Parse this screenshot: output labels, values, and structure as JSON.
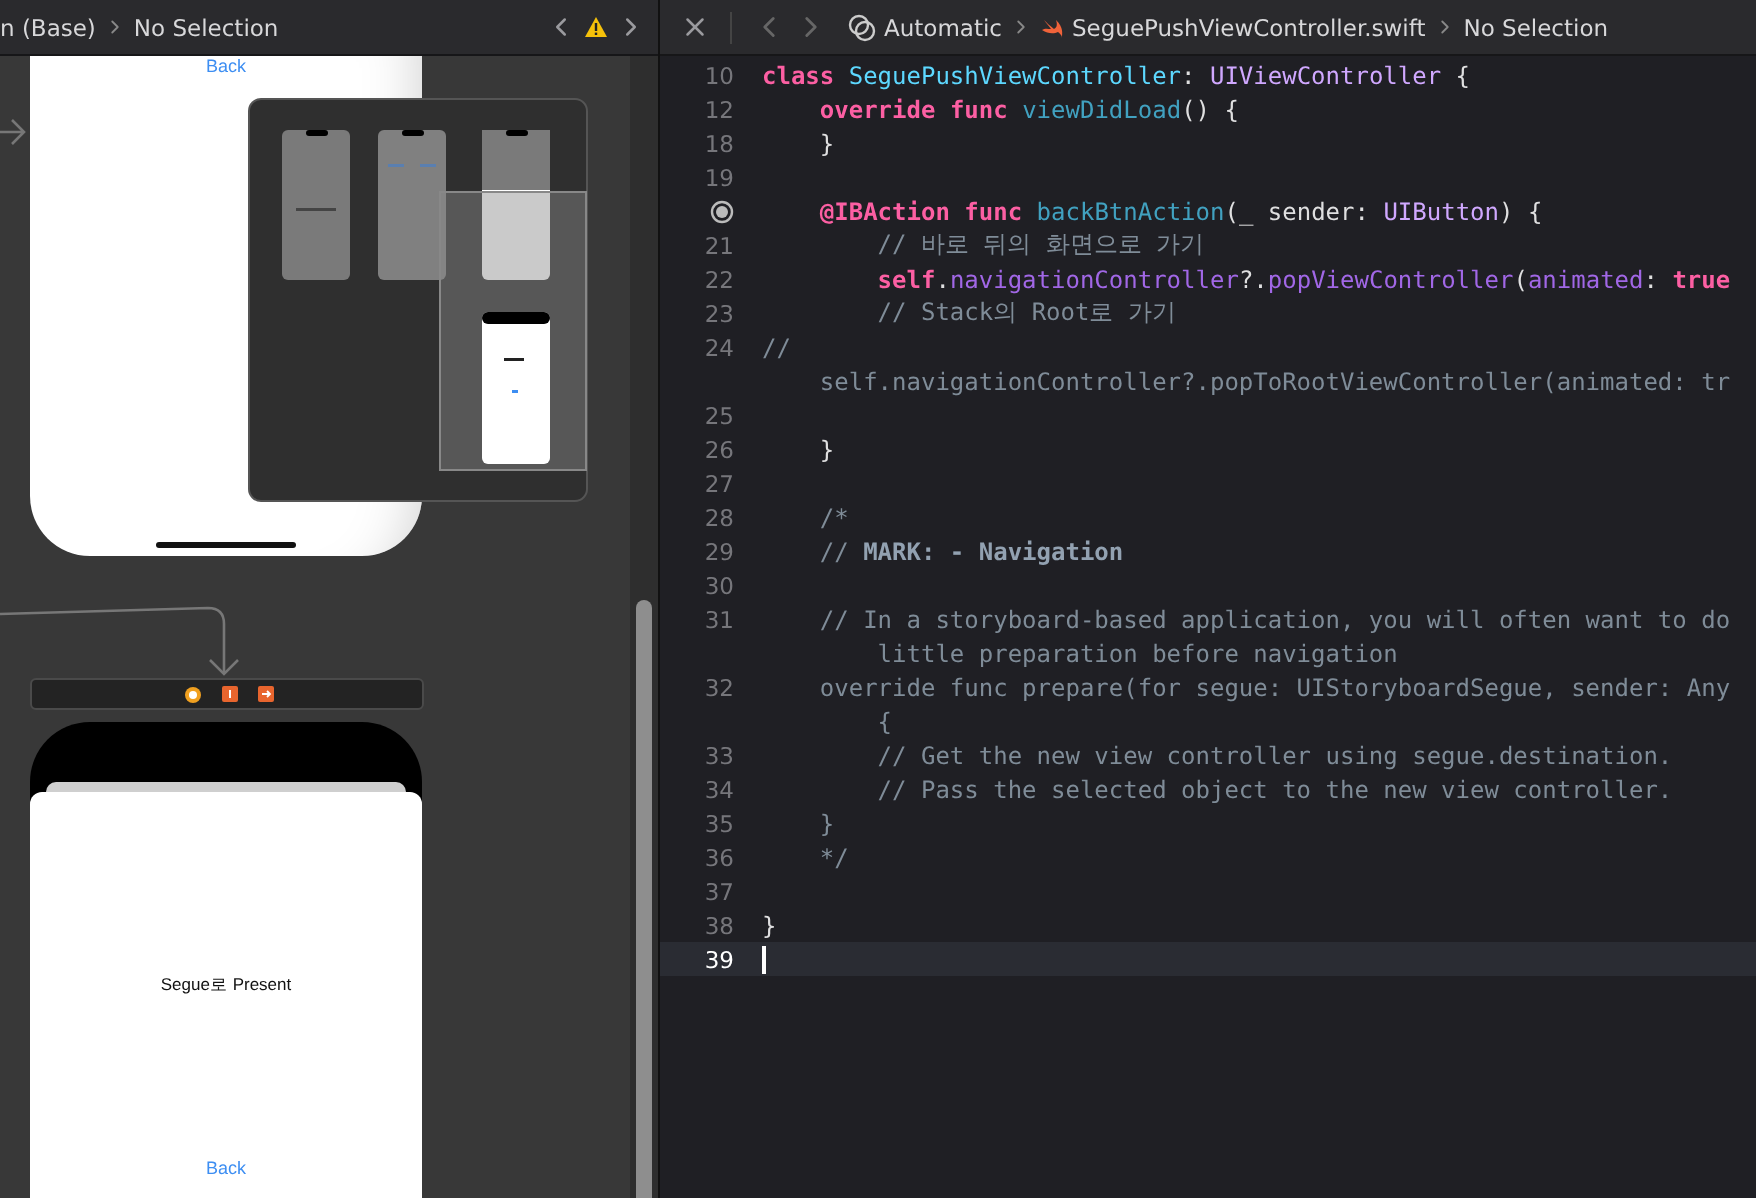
{
  "storyboard_bar": {
    "breadcrumb": [
      "n (Base)",
      "No Selection"
    ]
  },
  "storyboard": {
    "scenes": [
      {
        "kind": "pushed",
        "button": "Back"
      },
      {
        "kind": "presented",
        "label": "Segue로 Present",
        "button": "Back"
      }
    ]
  },
  "editor_bar": {
    "scheme": "Automatic",
    "file": "SeguePushViewController.swift",
    "selection": "No Selection"
  },
  "code": {
    "lines": [
      {
        "number": "10",
        "breakpoint": false,
        "selected": false,
        "rows": [
          [
            {
              "kind": "keyword",
              "text": "class"
            },
            {
              "kind": "plain",
              "text": " "
            },
            {
              "kind": "decl_type",
              "text": "SeguePushViewController"
            },
            {
              "kind": "plain",
              "text": ": "
            },
            {
              "kind": "type",
              "text": "UIViewController"
            },
            {
              "kind": "plain",
              "text": " {"
            }
          ]
        ]
      },
      {
        "number": "12",
        "breakpoint": false,
        "selected": false,
        "rows": [
          [
            {
              "kind": "keyword",
              "text": "    override"
            },
            {
              "kind": "plain",
              "text": " "
            },
            {
              "kind": "keyword",
              "text": "func"
            },
            {
              "kind": "plain",
              "text": " "
            },
            {
              "kind": "decl_func",
              "text": "viewDidLoad"
            },
            {
              "kind": "plain",
              "text": "() {"
            }
          ]
        ]
      },
      {
        "number": "18",
        "breakpoint": false,
        "selected": false,
        "rows": [
          [
            {
              "kind": "plain",
              "text": "    }"
            }
          ]
        ]
      },
      {
        "number": "19",
        "breakpoint": false,
        "selected": false
      },
      {
        "breakpoint": true,
        "selected": false,
        "rows": [
          [
            {
              "kind": "keyword",
              "text": "    @IBAction"
            },
            {
              "kind": "plain",
              "text": " "
            },
            {
              "kind": "keyword",
              "text": "func"
            },
            {
              "kind": "plain",
              "text": " "
            },
            {
              "kind": "decl_func",
              "text": "backBtnAction"
            },
            {
              "kind": "plain",
              "text": "(_ sender: "
            },
            {
              "kind": "type",
              "text": "UIButton"
            },
            {
              "kind": "plain",
              "text": ") {"
            }
          ]
        ]
      },
      {
        "number": "21",
        "breakpoint": false,
        "selected": false,
        "rows": [
          [
            {
              "kind": "comment",
              "text": "        // 바로 뒤의 화면으로 가기"
            }
          ]
        ]
      },
      {
        "number": "22",
        "breakpoint": false,
        "selected": false,
        "rows": [
          [
            {
              "kind": "keyword",
              "text": "        self"
            },
            {
              "kind": "plain",
              "text": "."
            },
            {
              "kind": "member",
              "text": "navigationController"
            },
            {
              "kind": "plain",
              "text": "?."
            },
            {
              "kind": "member",
              "text": "popViewController"
            },
            {
              "kind": "plain",
              "text": "("
            },
            {
              "kind": "member",
              "text": "animated"
            },
            {
              "kind": "plain",
              "text": ": "
            },
            {
              "kind": "keyword",
              "text": "true"
            }
          ]
        ]
      },
      {
        "number": "23",
        "breakpoint": false,
        "selected": false,
        "rows": [
          [
            {
              "kind": "comment",
              "text": "        // Stack의 Root로 가기"
            }
          ]
        ]
      },
      {
        "number": "24",
        "breakpoint": false,
        "selected": false,
        "rows": [
          [
            {
              "kind": "comment",
              "text": "//"
            }
          ],
          [
            {
              "kind": "comment",
              "text": "    self.navigationController?.popToRootViewController(animated: tr"
            }
          ]
        ]
      },
      {
        "number": "25",
        "breakpoint": false,
        "selected": false
      },
      {
        "number": "26",
        "breakpoint": false,
        "selected": false,
        "rows": [
          [
            {
              "kind": "plain",
              "text": "    }"
            }
          ]
        ]
      },
      {
        "number": "27",
        "breakpoint": false,
        "selected": false
      },
      {
        "number": "28",
        "breakpoint": false,
        "selected": false,
        "rows": [
          [
            {
              "kind": "comment",
              "text": "    /*"
            }
          ]
        ]
      },
      {
        "number": "29",
        "breakpoint": false,
        "selected": false,
        "rows": [
          [
            {
              "kind": "comment",
              "text": "    // "
            },
            {
              "kind": "mark",
              "text": "MARK: - Navigation"
            }
          ]
        ]
      },
      {
        "number": "30",
        "breakpoint": false,
        "selected": false
      },
      {
        "number": "31",
        "breakpoint": false,
        "selected": false,
        "rows": [
          [
            {
              "kind": "comment",
              "text": "    // In a storyboard-based application, you will often want to do"
            }
          ],
          [
            {
              "kind": "comment",
              "text": "        little preparation before navigation"
            }
          ]
        ]
      },
      {
        "number": "32",
        "breakpoint": false,
        "selected": false,
        "rows": [
          [
            {
              "kind": "comment",
              "text": "    override func prepare(for segue: UIStoryboardSegue, sender: Any"
            }
          ],
          [
            {
              "kind": "comment",
              "text": "        {"
            }
          ]
        ]
      },
      {
        "number": "33",
        "breakpoint": false,
        "selected": false,
        "rows": [
          [
            {
              "kind": "comment",
              "text": "        // Get the new view controller using segue.destination."
            }
          ]
        ]
      },
      {
        "number": "34",
        "breakpoint": false,
        "selected": false,
        "rows": [
          [
            {
              "kind": "comment",
              "text": "        // Pass the selected object to the new view controller."
            }
          ]
        ]
      },
      {
        "number": "35",
        "breakpoint": false,
        "selected": false,
        "rows": [
          [
            {
              "kind": "comment",
              "text": "    }"
            }
          ]
        ]
      },
      {
        "number": "36",
        "breakpoint": false,
        "selected": false,
        "rows": [
          [
            {
              "kind": "comment",
              "text": "    */"
            }
          ]
        ]
      },
      {
        "number": "37",
        "breakpoint": false,
        "selected": false
      },
      {
        "number": "38",
        "breakpoint": false,
        "selected": false,
        "rows": [
          [
            {
              "kind": "plain",
              "text": "}"
            }
          ]
        ]
      },
      {
        "number": "39",
        "breakpoint": false,
        "selected": true
      }
    ]
  }
}
